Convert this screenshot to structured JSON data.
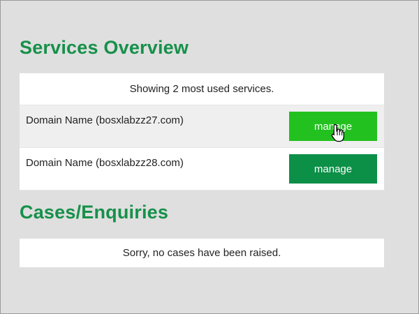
{
  "services": {
    "title": "Services Overview",
    "summary": "Showing 2 most used services.",
    "rows": [
      {
        "name": "Domain Name (bosxlabzz27.com)",
        "button_label": "manage",
        "state": "hover"
      },
      {
        "name": "Domain Name (bosxlabzz28.com)",
        "button_label": "manage",
        "state": "normal"
      }
    ]
  },
  "cases": {
    "title": "Cases/Enquiries",
    "empty_message": "Sorry, no cases have been raised."
  },
  "colors": {
    "accent_green": "#16904a",
    "button_hover": "#22c11f",
    "button_default": "#0c8f47",
    "page_background": "#dfdfdf"
  },
  "icons": {
    "cursor": "hand-pointer-icon"
  }
}
